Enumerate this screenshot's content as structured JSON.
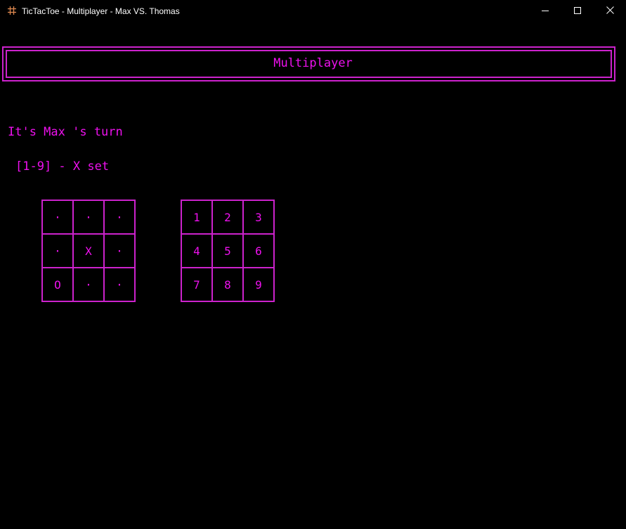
{
  "window": {
    "title": "TicTacToe - Multiplayer - Max VS. Thomas",
    "icon": "hash-icon",
    "accent_color": "#ee11ee",
    "background_color": "#000000"
  },
  "banner": {
    "title": "Multiplayer"
  },
  "status": {
    "turn_text": "It's Max 's turn",
    "hint_text": "[1-9] - X set"
  },
  "board": {
    "cells": [
      "·",
      "·",
      "·",
      "·",
      "X",
      "·",
      "O",
      "·",
      "·"
    ]
  },
  "keypad": {
    "keys": [
      "1",
      "2",
      "3",
      "4",
      "5",
      "6",
      "7",
      "8",
      "9"
    ]
  }
}
